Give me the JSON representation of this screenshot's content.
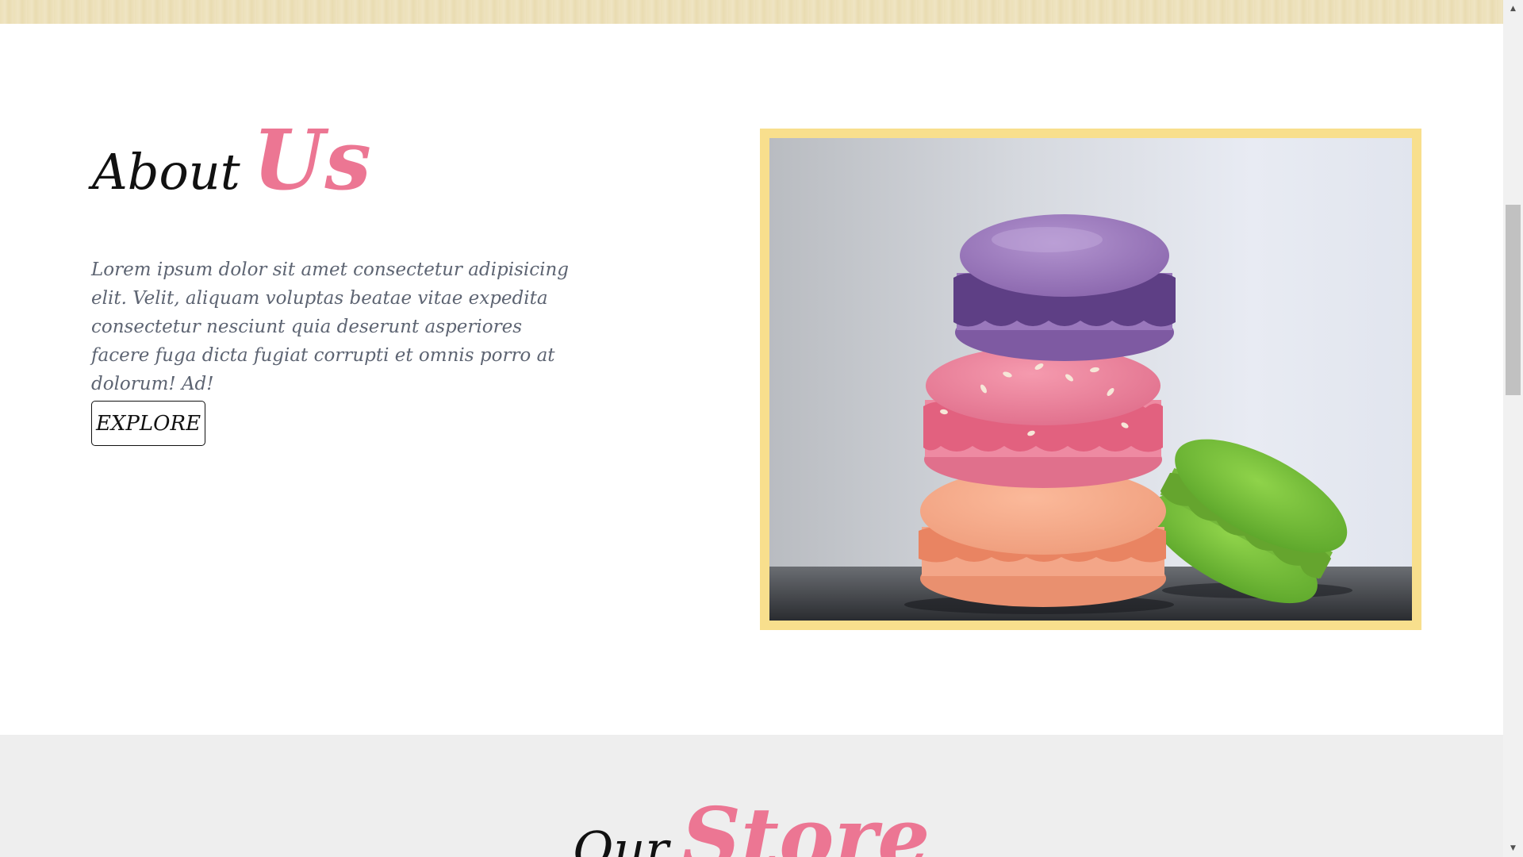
{
  "about": {
    "title_word1": "About",
    "title_word2": "Us",
    "body": "Lorem ipsum dolor sit amet consectetur adipisicing elit. Velit, aliquam voluptas beatae vitae expedita consectetur nesciunt quia deserunt asperiores facere fuga dicta fugiat corrupti et omnis porro at dolorum! Ad!",
    "button_label": "EXPLORE",
    "image": "macarons-stack-photo"
  },
  "store": {
    "title_word1": "Our",
    "title_word2": "Store"
  },
  "scrollbar": {
    "up_arrow": "▲",
    "down_arrow": "▼"
  },
  "colors": {
    "accent_pink": "#ec7693",
    "frame_yellow": "#f8df8d",
    "body_text": "#5d6472",
    "banner": "#ece0b8",
    "store_background": "#eeeeee"
  }
}
